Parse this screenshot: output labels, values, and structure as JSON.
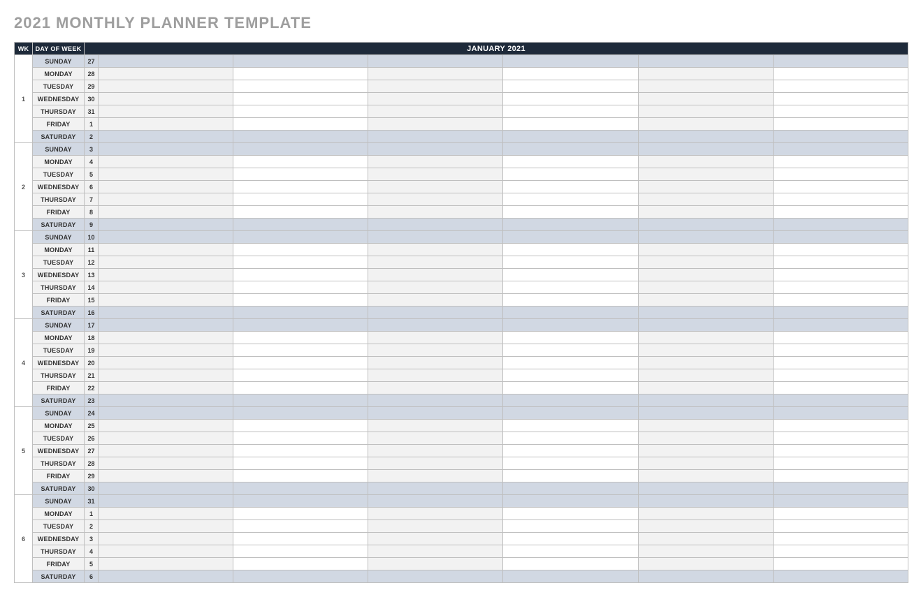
{
  "title": "2021 MONTHLY PLANNER TEMPLATE",
  "header": {
    "wk": "WK",
    "dow": "DAY OF WEEK",
    "month": "JANUARY 2021"
  },
  "dayNames": [
    "SUNDAY",
    "MONDAY",
    "TUESDAY",
    "WEDNESDAY",
    "THURSDAY",
    "FRIDAY",
    "SATURDAY"
  ],
  "weeks": [
    {
      "num": "1",
      "dates": [
        "27",
        "28",
        "29",
        "30",
        "31",
        "1",
        "2"
      ]
    },
    {
      "num": "2",
      "dates": [
        "3",
        "4",
        "5",
        "6",
        "7",
        "8",
        "9"
      ]
    },
    {
      "num": "3",
      "dates": [
        "10",
        "11",
        "12",
        "13",
        "14",
        "15",
        "16"
      ]
    },
    {
      "num": "4",
      "dates": [
        "17",
        "18",
        "19",
        "20",
        "21",
        "22",
        "23"
      ]
    },
    {
      "num": "5",
      "dates": [
        "24",
        "25",
        "26",
        "27",
        "28",
        "29",
        "30"
      ]
    },
    {
      "num": "6",
      "dates": [
        "31",
        "1",
        "2",
        "3",
        "4",
        "5",
        "6"
      ]
    }
  ]
}
